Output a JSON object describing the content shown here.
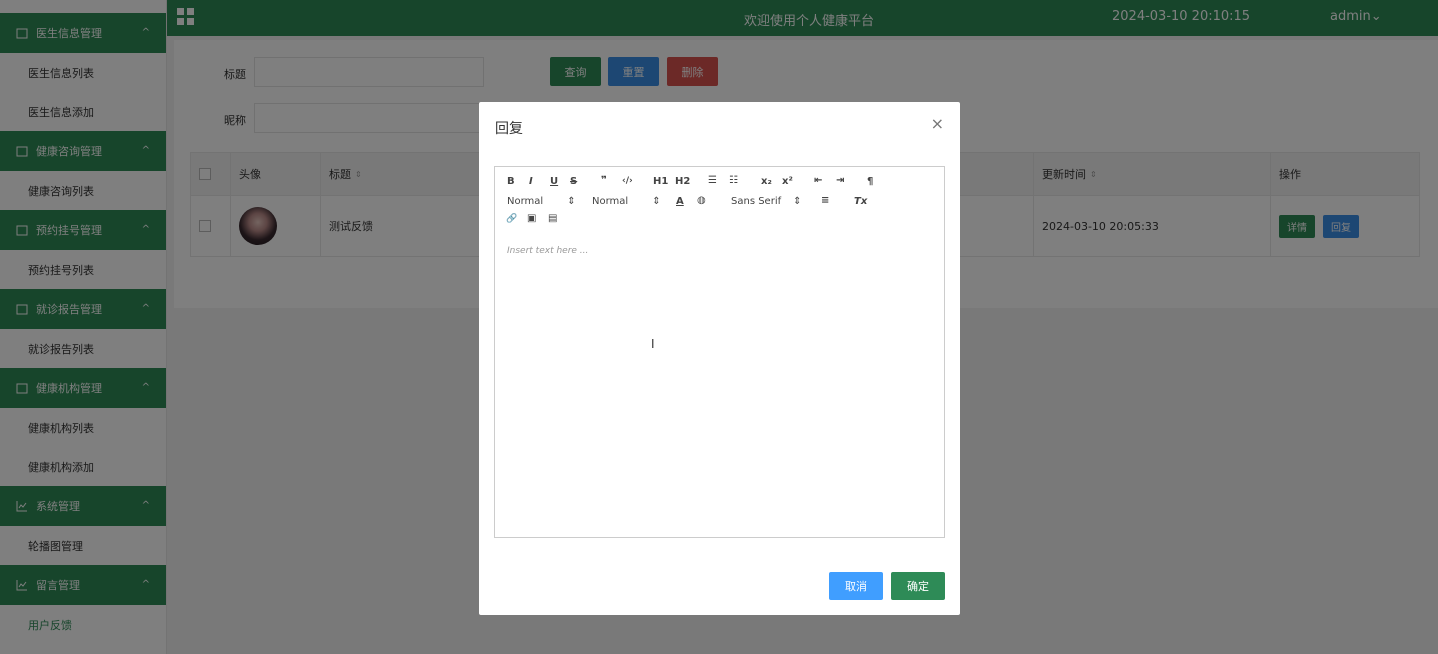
{
  "sidebar": {
    "groups": [
      {
        "label": "医生信息管理",
        "items": [
          "医生信息列表",
          "医生信息添加"
        ]
      },
      {
        "label": "健康咨询管理",
        "items": [
          "健康咨询列表"
        ]
      },
      {
        "label": "预约挂号管理",
        "items": [
          "预约挂号列表"
        ]
      },
      {
        "label": "就诊报告管理",
        "items": [
          "就诊报告列表"
        ]
      },
      {
        "label": "健康机构管理",
        "items": [
          "健康机构列表",
          "健康机构添加"
        ]
      },
      {
        "label": "系统管理",
        "items": [
          "轮播图管理"
        ]
      },
      {
        "label": "留言管理",
        "items": [
          "用户反馈"
        ]
      }
    ],
    "caret": "^"
  },
  "topbar": {
    "title": "欢迎使用个人健康平台",
    "datetime": "2024-03-10 20:10:15",
    "user": "admin",
    "user_caret": "⌄"
  },
  "search": {
    "title_label": "标题",
    "nickname_label": "昵称",
    "query_button": "查询",
    "reset_button": "重置",
    "delete_button": "删除"
  },
  "table": {
    "headers": {
      "avatar": "头像",
      "title": "标题",
      "updated": "更新时间",
      "actions": "操作"
    },
    "sort_glyph": "⇕",
    "rows": [
      {
        "title": "测试反馈",
        "updated": "2024-03-10 20:05:33",
        "detail": "详情",
        "reply": "回复"
      }
    ]
  },
  "modal": {
    "title": "回复",
    "close": "×",
    "editor": {
      "placeholder": "Insert text here ...",
      "header_select": "Normal",
      "size_select": "Normal",
      "font_select": "Sans Serif",
      "select_arrow": "⇕",
      "tools": {
        "bold": "B",
        "italic": "I",
        "underline": "U",
        "strike": "S",
        "quote": "❞",
        "code": "‹/›",
        "h1": "H1",
        "h2": "H2",
        "ordered": "☰",
        "bullet": "☷",
        "sub": "x₂",
        "sup": "x²",
        "outdent": "⇤",
        "indent": "⇥",
        "direction": "¶",
        "color": "A",
        "background": "◍",
        "align": "≡",
        "clean": "Tx",
        "link": "🔗",
        "image": "▣",
        "video": "▤"
      }
    },
    "cancel_button": "取消",
    "confirm_button": "确定"
  },
  "colors": {
    "primary_green": "#2e8b57",
    "blue": "#3a8ee6",
    "red": "#d9534f",
    "light_blue": "#409eff"
  }
}
